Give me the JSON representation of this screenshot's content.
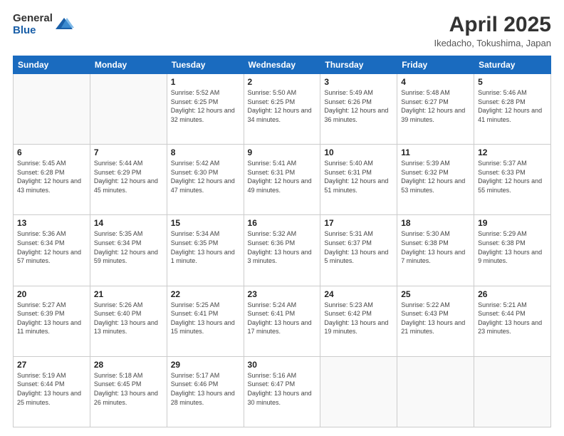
{
  "header": {
    "logo_line1": "General",
    "logo_line2": "Blue",
    "title": "April 2025",
    "subtitle": "Ikedacho, Tokushima, Japan"
  },
  "weekdays": [
    "Sunday",
    "Monday",
    "Tuesday",
    "Wednesday",
    "Thursday",
    "Friday",
    "Saturday"
  ],
  "weeks": [
    [
      {
        "day": "",
        "sunrise": "",
        "sunset": "",
        "daylight": "",
        "empty": true
      },
      {
        "day": "",
        "sunrise": "",
        "sunset": "",
        "daylight": "",
        "empty": true
      },
      {
        "day": "1",
        "sunrise": "Sunrise: 5:52 AM",
        "sunset": "Sunset: 6:25 PM",
        "daylight": "Daylight: 12 hours and 32 minutes."
      },
      {
        "day": "2",
        "sunrise": "Sunrise: 5:50 AM",
        "sunset": "Sunset: 6:25 PM",
        "daylight": "Daylight: 12 hours and 34 minutes."
      },
      {
        "day": "3",
        "sunrise": "Sunrise: 5:49 AM",
        "sunset": "Sunset: 6:26 PM",
        "daylight": "Daylight: 12 hours and 36 minutes."
      },
      {
        "day": "4",
        "sunrise": "Sunrise: 5:48 AM",
        "sunset": "Sunset: 6:27 PM",
        "daylight": "Daylight: 12 hours and 39 minutes."
      },
      {
        "day": "5",
        "sunrise": "Sunrise: 5:46 AM",
        "sunset": "Sunset: 6:28 PM",
        "daylight": "Daylight: 12 hours and 41 minutes."
      }
    ],
    [
      {
        "day": "6",
        "sunrise": "Sunrise: 5:45 AM",
        "sunset": "Sunset: 6:28 PM",
        "daylight": "Daylight: 12 hours and 43 minutes."
      },
      {
        "day": "7",
        "sunrise": "Sunrise: 5:44 AM",
        "sunset": "Sunset: 6:29 PM",
        "daylight": "Daylight: 12 hours and 45 minutes."
      },
      {
        "day": "8",
        "sunrise": "Sunrise: 5:42 AM",
        "sunset": "Sunset: 6:30 PM",
        "daylight": "Daylight: 12 hours and 47 minutes."
      },
      {
        "day": "9",
        "sunrise": "Sunrise: 5:41 AM",
        "sunset": "Sunset: 6:31 PM",
        "daylight": "Daylight: 12 hours and 49 minutes."
      },
      {
        "day": "10",
        "sunrise": "Sunrise: 5:40 AM",
        "sunset": "Sunset: 6:31 PM",
        "daylight": "Daylight: 12 hours and 51 minutes."
      },
      {
        "day": "11",
        "sunrise": "Sunrise: 5:39 AM",
        "sunset": "Sunset: 6:32 PM",
        "daylight": "Daylight: 12 hours and 53 minutes."
      },
      {
        "day": "12",
        "sunrise": "Sunrise: 5:37 AM",
        "sunset": "Sunset: 6:33 PM",
        "daylight": "Daylight: 12 hours and 55 minutes."
      }
    ],
    [
      {
        "day": "13",
        "sunrise": "Sunrise: 5:36 AM",
        "sunset": "Sunset: 6:34 PM",
        "daylight": "Daylight: 12 hours and 57 minutes."
      },
      {
        "day": "14",
        "sunrise": "Sunrise: 5:35 AM",
        "sunset": "Sunset: 6:34 PM",
        "daylight": "Daylight: 12 hours and 59 minutes."
      },
      {
        "day": "15",
        "sunrise": "Sunrise: 5:34 AM",
        "sunset": "Sunset: 6:35 PM",
        "daylight": "Daylight: 13 hours and 1 minute."
      },
      {
        "day": "16",
        "sunrise": "Sunrise: 5:32 AM",
        "sunset": "Sunset: 6:36 PM",
        "daylight": "Daylight: 13 hours and 3 minutes."
      },
      {
        "day": "17",
        "sunrise": "Sunrise: 5:31 AM",
        "sunset": "Sunset: 6:37 PM",
        "daylight": "Daylight: 13 hours and 5 minutes."
      },
      {
        "day": "18",
        "sunrise": "Sunrise: 5:30 AM",
        "sunset": "Sunset: 6:38 PM",
        "daylight": "Daylight: 13 hours and 7 minutes."
      },
      {
        "day": "19",
        "sunrise": "Sunrise: 5:29 AM",
        "sunset": "Sunset: 6:38 PM",
        "daylight": "Daylight: 13 hours and 9 minutes."
      }
    ],
    [
      {
        "day": "20",
        "sunrise": "Sunrise: 5:27 AM",
        "sunset": "Sunset: 6:39 PM",
        "daylight": "Daylight: 13 hours and 11 minutes."
      },
      {
        "day": "21",
        "sunrise": "Sunrise: 5:26 AM",
        "sunset": "Sunset: 6:40 PM",
        "daylight": "Daylight: 13 hours and 13 minutes."
      },
      {
        "day": "22",
        "sunrise": "Sunrise: 5:25 AM",
        "sunset": "Sunset: 6:41 PM",
        "daylight": "Daylight: 13 hours and 15 minutes."
      },
      {
        "day": "23",
        "sunrise": "Sunrise: 5:24 AM",
        "sunset": "Sunset: 6:41 PM",
        "daylight": "Daylight: 13 hours and 17 minutes."
      },
      {
        "day": "24",
        "sunrise": "Sunrise: 5:23 AM",
        "sunset": "Sunset: 6:42 PM",
        "daylight": "Daylight: 13 hours and 19 minutes."
      },
      {
        "day": "25",
        "sunrise": "Sunrise: 5:22 AM",
        "sunset": "Sunset: 6:43 PM",
        "daylight": "Daylight: 13 hours and 21 minutes."
      },
      {
        "day": "26",
        "sunrise": "Sunrise: 5:21 AM",
        "sunset": "Sunset: 6:44 PM",
        "daylight": "Daylight: 13 hours and 23 minutes."
      }
    ],
    [
      {
        "day": "27",
        "sunrise": "Sunrise: 5:19 AM",
        "sunset": "Sunset: 6:44 PM",
        "daylight": "Daylight: 13 hours and 25 minutes."
      },
      {
        "day": "28",
        "sunrise": "Sunrise: 5:18 AM",
        "sunset": "Sunset: 6:45 PM",
        "daylight": "Daylight: 13 hours and 26 minutes."
      },
      {
        "day": "29",
        "sunrise": "Sunrise: 5:17 AM",
        "sunset": "Sunset: 6:46 PM",
        "daylight": "Daylight: 13 hours and 28 minutes."
      },
      {
        "day": "30",
        "sunrise": "Sunrise: 5:16 AM",
        "sunset": "Sunset: 6:47 PM",
        "daylight": "Daylight: 13 hours and 30 minutes."
      },
      {
        "day": "",
        "sunrise": "",
        "sunset": "",
        "daylight": "",
        "empty": true
      },
      {
        "day": "",
        "sunrise": "",
        "sunset": "",
        "daylight": "",
        "empty": true
      },
      {
        "day": "",
        "sunrise": "",
        "sunset": "",
        "daylight": "",
        "empty": true
      }
    ]
  ]
}
